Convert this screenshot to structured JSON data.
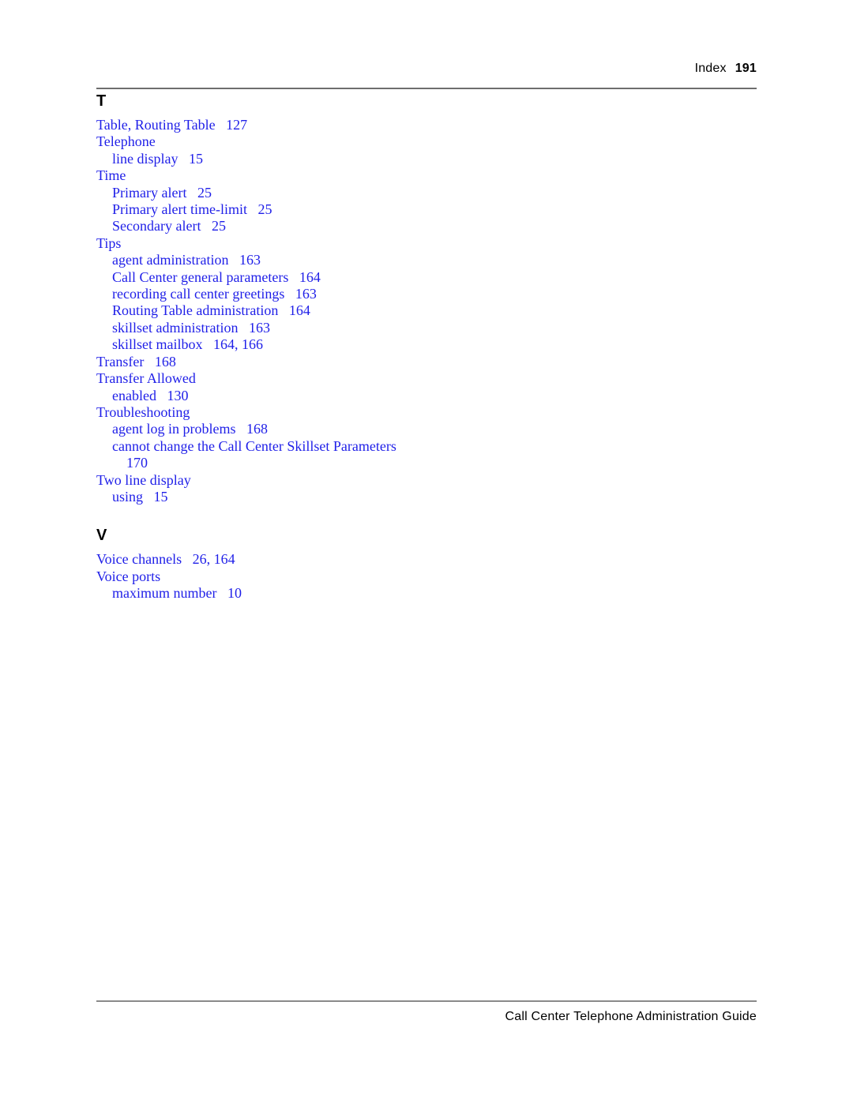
{
  "header": {
    "label": "Index",
    "page_number": "191"
  },
  "footer": {
    "title": "Call Center Telephone Administration Guide"
  },
  "colors": {
    "entry_text": "#1f1fe8",
    "heading_text": "#000000",
    "rule": "#6e6e6e"
  },
  "index": {
    "sections": [
      {
        "letter": "T",
        "entries": [
          {
            "level": 1,
            "text": "Table, Routing Table   127"
          },
          {
            "level": 1,
            "text": "Telephone"
          },
          {
            "level": 2,
            "text": "line display   15"
          },
          {
            "level": 1,
            "text": "Time"
          },
          {
            "level": 2,
            "text": "Primary alert   25"
          },
          {
            "level": 2,
            "text": "Primary alert time-limit   25"
          },
          {
            "level": 2,
            "text": "Secondary alert   25"
          },
          {
            "level": 1,
            "text": "Tips"
          },
          {
            "level": 2,
            "text": "agent administration   163"
          },
          {
            "level": 2,
            "text": "Call Center general parameters   164"
          },
          {
            "level": 2,
            "text": "recording call center greetings   163"
          },
          {
            "level": 2,
            "text": "Routing Table administration   164"
          },
          {
            "level": 2,
            "text": "skillset administration   163"
          },
          {
            "level": 2,
            "text": "skillset mailbox   164, 166"
          },
          {
            "level": 1,
            "text": "Transfer   168"
          },
          {
            "level": 1,
            "text": "Transfer Allowed"
          },
          {
            "level": 2,
            "text": "enabled   130"
          },
          {
            "level": 1,
            "text": "Troubleshooting"
          },
          {
            "level": 2,
            "text": "agent log in problems   168"
          },
          {
            "level": 2,
            "text": "cannot change the Call Center Skillset Parameters"
          },
          {
            "level": 3,
            "text": "170"
          },
          {
            "level": 1,
            "text": "Two line display"
          },
          {
            "level": 2,
            "text": "using   15"
          }
        ]
      },
      {
        "letter": "V",
        "entries": [
          {
            "level": 1,
            "text": "Voice channels   26, 164"
          },
          {
            "level": 1,
            "text": "Voice ports"
          },
          {
            "level": 2,
            "text": "maximum number   10"
          }
        ]
      }
    ]
  }
}
